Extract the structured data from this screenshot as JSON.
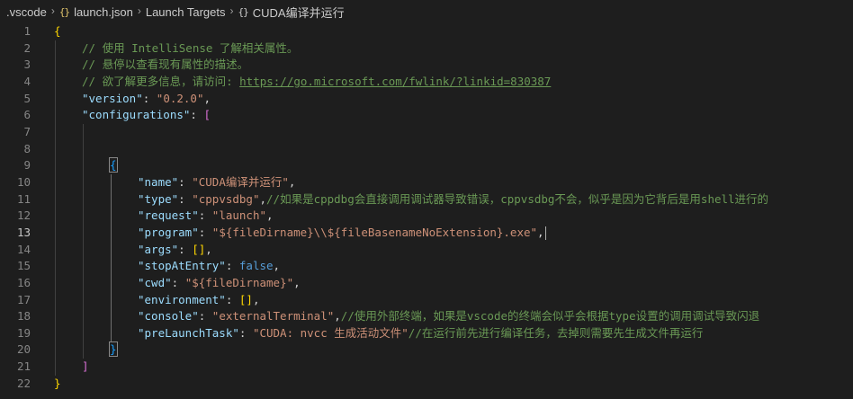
{
  "breadcrumb": {
    "items": [
      {
        "label": ".vscode",
        "icon": "none"
      },
      {
        "label": "launch.json",
        "icon": "json-braces-icon"
      },
      {
        "label": "Launch Targets",
        "icon": "none"
      },
      {
        "label": "CUDA编译并运行",
        "icon": "object-braces-icon"
      }
    ],
    "separator": "›",
    "json_icon_glyph": "{}",
    "object_icon_glyph": "{}"
  },
  "editor": {
    "current_line": 13,
    "colors": {
      "background": "#1e1e1e",
      "key": "#9cdcfe",
      "string": "#ce9178",
      "comment": "#6a9955",
      "keyword": "#569cd6",
      "bracket_level1": "#ffd700",
      "bracket_level2": "#da70d6",
      "bracket_level3": "#179fff"
    },
    "lines": [
      {
        "n": "1",
        "tokens": [
          [
            "b1",
            "{"
          ]
        ]
      },
      {
        "n": "2",
        "tokens": [
          [
            "cmt",
            "// 使用 IntelliSense 了解相关属性。"
          ]
        ]
      },
      {
        "n": "3",
        "tokens": [
          [
            "cmt",
            "// 悬停以查看现有属性的描述。"
          ]
        ]
      },
      {
        "n": "4",
        "tokens": [
          [
            "cmt",
            "// 欲了解更多信息，请访问: "
          ],
          [
            "link",
            "https://go.microsoft.com/fwlink/?linkid=830387"
          ]
        ]
      },
      {
        "n": "5",
        "tokens": [
          [
            "key",
            "\"version\""
          ],
          [
            "p",
            ": "
          ],
          [
            "str",
            "\"0.2.0\""
          ],
          [
            "p",
            ","
          ]
        ]
      },
      {
        "n": "6",
        "tokens": [
          [
            "key",
            "\"configurations\""
          ],
          [
            "p",
            ": "
          ],
          [
            "b2",
            "["
          ]
        ]
      },
      {
        "n": "7",
        "tokens": []
      },
      {
        "n": "8",
        "tokens": []
      },
      {
        "n": "9",
        "tokens": [
          [
            "b3",
            "{"
          ]
        ]
      },
      {
        "n": "10",
        "tokens": [
          [
            "key",
            "\"name\""
          ],
          [
            "p",
            ": "
          ],
          [
            "str",
            "\"CUDA编译并运行\""
          ],
          [
            "p",
            ","
          ]
        ]
      },
      {
        "n": "11",
        "tokens": [
          [
            "key",
            "\"type\""
          ],
          [
            "p",
            ": "
          ],
          [
            "str",
            "\"cppvsdbg\""
          ],
          [
            "p",
            ","
          ],
          [
            "cmt",
            "//如果是cppdbg会直接调用调试器导致错误，cppvsdbg不会，似乎是因为它背后是用shell进行的"
          ]
        ]
      },
      {
        "n": "12",
        "tokens": [
          [
            "key",
            "\"request\""
          ],
          [
            "p",
            ": "
          ],
          [
            "str",
            "\"launch\""
          ],
          [
            "p",
            ","
          ]
        ]
      },
      {
        "n": "13",
        "tokens": [
          [
            "key",
            "\"program\""
          ],
          [
            "p",
            ": "
          ],
          [
            "str",
            "\"${fileDirname}\\\\${fileBasenameNoExtension}.exe\""
          ],
          [
            "p",
            ","
          ]
        ]
      },
      {
        "n": "14",
        "tokens": [
          [
            "key",
            "\"args\""
          ],
          [
            "p",
            ": "
          ],
          [
            "b1",
            "[]"
          ],
          [
            "p",
            ","
          ]
        ]
      },
      {
        "n": "15",
        "tokens": [
          [
            "key",
            "\"stopAtEntry\""
          ],
          [
            "p",
            ": "
          ],
          [
            "kw",
            "false"
          ],
          [
            "p",
            ","
          ]
        ]
      },
      {
        "n": "16",
        "tokens": [
          [
            "key",
            "\"cwd\""
          ],
          [
            "p",
            ": "
          ],
          [
            "str",
            "\"${fileDirname}\""
          ],
          [
            "p",
            ","
          ]
        ]
      },
      {
        "n": "17",
        "tokens": [
          [
            "key",
            "\"environment\""
          ],
          [
            "p",
            ": "
          ],
          [
            "b1",
            "[]"
          ],
          [
            "p",
            ","
          ]
        ]
      },
      {
        "n": "18",
        "tokens": [
          [
            "key",
            "\"console\""
          ],
          [
            "p",
            ": "
          ],
          [
            "str",
            "\"externalTerminal\""
          ],
          [
            "p",
            ","
          ],
          [
            "cmt",
            "//使用外部终端，如果是vscode的终端会似乎会根据type设置的调用调试导致闪退"
          ]
        ]
      },
      {
        "n": "19",
        "tokens": [
          [
            "key",
            "\"preLaunchTask\""
          ],
          [
            "p",
            ": "
          ],
          [
            "str",
            "\"CUDA: nvcc 生成活动文件\""
          ],
          [
            "cmt",
            "//在运行前先进行编译任务，去掉则需要先生成文件再运行"
          ]
        ]
      },
      {
        "n": "20",
        "tokens": [
          [
            "b3",
            "}"
          ]
        ]
      },
      {
        "n": "21",
        "tokens": [
          [
            "b2",
            "]"
          ]
        ]
      },
      {
        "n": "22",
        "tokens": [
          [
            "b1",
            "}"
          ]
        ]
      }
    ]
  }
}
